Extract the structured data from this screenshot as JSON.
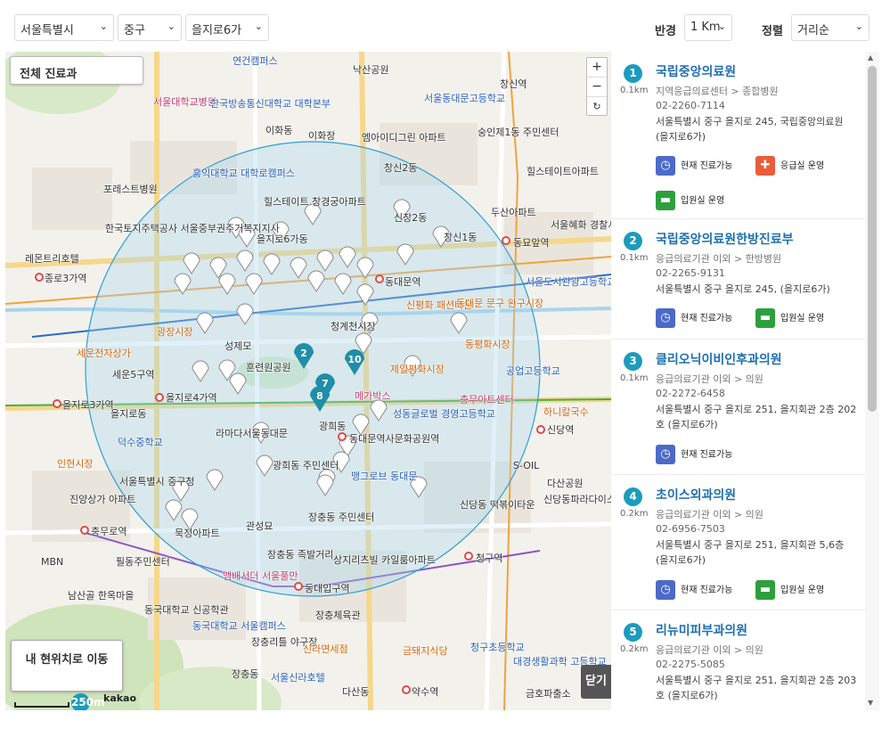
{
  "filters": {
    "city": "서울특별시",
    "district": "중구",
    "dong": "을지로6가",
    "radius_label": "반경",
    "radius_value": "1 Km",
    "sort_label": "정렬",
    "sort_value": "거리순"
  },
  "map": {
    "all_departments_button": "전체 진료과",
    "my_location_button": "내 현위치로 이동",
    "close_button": "닫기",
    "zoom_in": "+",
    "zoom_out": "−",
    "reset": "↻",
    "scale_label": "250m",
    "brand": "kakao",
    "labels": [
      {
        "t": "연건캠퍼스",
        "c": "blue"
      },
      {
        "t": "낙산공원",
        "c": ""
      },
      {
        "t": "서울대학교병원",
        "c": "pink"
      },
      {
        "t": "한국방송통신대학교 대학본부",
        "c": "blue"
      },
      {
        "t": "이화동",
        "c": ""
      },
      {
        "t": "이화장",
        "c": ""
      },
      {
        "t": "엠아이디그린 아파트",
        "c": ""
      },
      {
        "t": "창신2동",
        "c": ""
      },
      {
        "t": "창신역",
        "c": ""
      },
      {
        "t": "숭인제1동 주민센터",
        "c": ""
      },
      {
        "t": "서울동대문고등학교",
        "c": "blue"
      },
      {
        "t": "힐스테이트아파트",
        "c": ""
      },
      {
        "t": "홍익대학교 대학로캠퍼스",
        "c": "blue"
      },
      {
        "t": "포레스트병원",
        "c": ""
      },
      {
        "t": "힐스테이트 창경궁아파트",
        "c": ""
      },
      {
        "t": "두산아파트",
        "c": ""
      },
      {
        "t": "서울혜화 경찰서",
        "c": ""
      },
      {
        "t": "한국토지주택공사 서울중부권주거복지지사",
        "c": ""
      },
      {
        "t": "을지로6가동",
        "c": ""
      },
      {
        "t": "광희동",
        "c": ""
      },
      {
        "t": "신창2동",
        "c": ""
      },
      {
        "t": "창신1동",
        "c": ""
      },
      {
        "t": "동묘앞역",
        "c": ""
      },
      {
        "t": "종로3가역",
        "c": ""
      },
      {
        "t": "레몬트리호텔",
        "c": ""
      },
      {
        "t": "동대문역",
        "c": ""
      },
      {
        "t": "서울도시관광고등학교",
        "c": "blue"
      },
      {
        "t": "신평화 패션타운",
        "c": "orange"
      },
      {
        "t": "동대문 문구 완구시장",
        "c": "orange"
      },
      {
        "t": "청계천시장",
        "c": ""
      },
      {
        "t": "광장시장",
        "c": "orange"
      },
      {
        "t": "세운전자상가",
        "c": "orange"
      },
      {
        "t": "성제모",
        "c": ""
      },
      {
        "t": "훈련원공원",
        "c": ""
      },
      {
        "t": "동평화시장",
        "c": "orange"
      },
      {
        "t": "제일평화시장",
        "c": "orange"
      },
      {
        "t": "공업고등학교",
        "c": "blue"
      },
      {
        "t": "세운5구역",
        "c": ""
      },
      {
        "t": "을지로4가역",
        "c": ""
      },
      {
        "t": "을지로3가역",
        "c": ""
      },
      {
        "t": "을지로동",
        "c": ""
      },
      {
        "t": "메가박스",
        "c": "pink"
      },
      {
        "t": "충무아트센터",
        "c": "pink"
      },
      {
        "t": "하니칼국수",
        "c": "orange"
      },
      {
        "t": "성동글로벌 경영고등학교",
        "c": "blue"
      },
      {
        "t": "동대문역사문화공원역",
        "c": ""
      },
      {
        "t": "신당역",
        "c": ""
      },
      {
        "t": "라마다서울동대문",
        "c": ""
      },
      {
        "t": "덕수중학교",
        "c": "blue"
      },
      {
        "t": "인현시장",
        "c": "orange"
      },
      {
        "t": "광희동 주민센터",
        "c": ""
      },
      {
        "t": "맹그로브 동대문",
        "c": "blue"
      },
      {
        "t": "S-OIL",
        "c": ""
      },
      {
        "t": "서울특별시 중구청",
        "c": ""
      },
      {
        "t": "진양상가 아파트",
        "c": ""
      },
      {
        "t": "다산공원",
        "c": ""
      },
      {
        "t": "신당동파라다이스",
        "c": ""
      },
      {
        "t": "신당동 떡볶이타운",
        "c": ""
      },
      {
        "t": "충무로역",
        "c": ""
      },
      {
        "t": "묵정아파트",
        "c": ""
      },
      {
        "t": "관성묘",
        "c": ""
      },
      {
        "t": "장충동 주민센터",
        "c": ""
      },
      {
        "t": "장충동 족발거리",
        "c": ""
      },
      {
        "t": "상지리츠빌 카일룸아파트",
        "c": ""
      },
      {
        "t": "청구역",
        "c": ""
      },
      {
        "t": "MBN",
        "c": ""
      },
      {
        "t": "필동주민센터",
        "c": ""
      },
      {
        "t": "앰배서더 서울풀만",
        "c": "pink"
      },
      {
        "t": "동대입구역",
        "c": ""
      },
      {
        "t": "남산골 한옥마을",
        "c": ""
      },
      {
        "t": "동국대학교 신공학관",
        "c": ""
      },
      {
        "t": "동국대학교 서울캠퍼스",
        "c": "blue"
      },
      {
        "t": "장충체육관",
        "c": ""
      },
      {
        "t": "장충리틀 야구장",
        "c": ""
      },
      {
        "t": "신라면세점",
        "c": "orange"
      },
      {
        "t": "금돼지식당",
        "c": "orange"
      },
      {
        "t": "청구초등학교",
        "c": "blue"
      },
      {
        "t": "대경생활과학 고등학교",
        "c": "blue"
      },
      {
        "t": "다산동",
        "c": ""
      },
      {
        "t": "약수역",
        "c": ""
      },
      {
        "t": "금호파출소",
        "c": ""
      },
      {
        "t": "서울신라호텔",
        "c": "blue"
      },
      {
        "t": "장충동",
        "c": ""
      }
    ],
    "clusters": [
      "2",
      "7",
      "8",
      "10"
    ]
  },
  "results": [
    {
      "no": "1",
      "distance": "0.1km",
      "name": "국립중앙의료원",
      "category": "지역응급의료센터 > 종합병원",
      "phone": "02-2260-7114",
      "address": "서울특별시 중구 을지로 245, 국립중앙의료원 (을지로6가)",
      "badges": [
        {
          "icon": "clock-icon",
          "label": "현재 진료가능"
        },
        {
          "icon": "emergency-icon",
          "label": "응급실 운영"
        },
        {
          "icon": "bed-icon",
          "label": "입원실 운영"
        }
      ]
    },
    {
      "no": "2",
      "distance": "0.1km",
      "name": "국립중앙의료원한방진료부",
      "category": "응급의료기관 이외 > 한방병원",
      "phone": "02-2265-9131",
      "address": "서울특별시 중구 을지로 245, (을지로6가)",
      "badges": [
        {
          "icon": "clock-icon",
          "label": "현재 진료가능"
        },
        {
          "icon": "bed-icon",
          "label": "입원실 운영"
        }
      ]
    },
    {
      "no": "3",
      "distance": "0.1km",
      "name": "클리오닉이비인후과의원",
      "category": "응급의료기관 이외 > 의원",
      "phone": "02-2272-6458",
      "address": "서울특별시 중구 을지로 251, 을지회관 2층 202호 (을지로6가)",
      "badges": [
        {
          "icon": "clock-icon",
          "label": "현재 진료가능"
        }
      ]
    },
    {
      "no": "4",
      "distance": "0.2km",
      "name": "초이스외과의원",
      "category": "응급의료기관 이외 > 의원",
      "phone": "02-6956-7503",
      "address": "서울특별시 중구 을지로 251, 을지회관 5,6층 (을지로6가)",
      "badges": [
        {
          "icon": "clock-icon",
          "label": "현재 진료가능"
        },
        {
          "icon": "bed-icon",
          "label": "입원실 운영"
        }
      ]
    },
    {
      "no": "5",
      "distance": "0.2km",
      "name": "리뉴미피부과의원",
      "category": "응급의료기관 이외 > 의원",
      "phone": "02-2275-5085",
      "address": "서울특별시 중구 을지로 251, 을지회관 2층 203호 (을지로6가)",
      "badges": []
    }
  ],
  "colors": {
    "accent": "#1b9cbd",
    "name_blue": "#1f6faf",
    "radius_circle": "#2ea0d8",
    "clock": "#4c6ac8",
    "emergency": "#e85d3a",
    "bed": "#2e9f3e"
  }
}
